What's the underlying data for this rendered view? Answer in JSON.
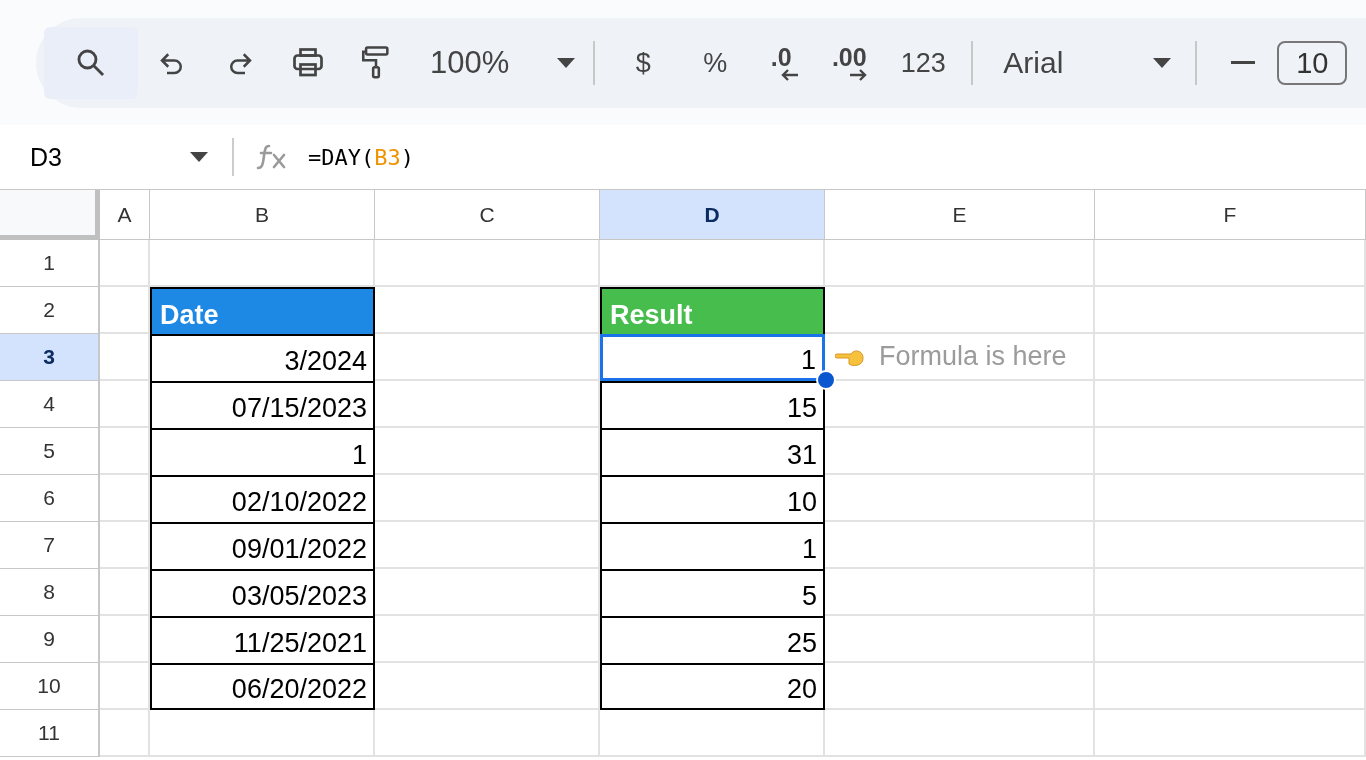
{
  "toolbar": [
    {
      "kind": "search"
    },
    {
      "kind": "undo"
    },
    {
      "kind": "redo"
    },
    {
      "kind": "print"
    },
    {
      "kind": "paint-format"
    },
    {
      "kind": "zoom",
      "text": "100%"
    },
    {
      "kind": "separator"
    },
    {
      "kind": "text",
      "text": "$"
    },
    {
      "kind": "text",
      "text": "%"
    },
    {
      "kind": "decimal-decrease",
      "text": ".0"
    },
    {
      "kind": "decimal-increase",
      "text": ".00"
    },
    {
      "kind": "text",
      "text": "123"
    },
    {
      "kind": "separator"
    },
    {
      "kind": "font",
      "text": "Arial"
    },
    {
      "kind": "separator"
    },
    {
      "kind": "minus"
    },
    {
      "kind": "font-size",
      "text": "10"
    }
  ],
  "name_box": "D3",
  "formula": [
    {
      "text": "=DAY(",
      "kind": "plain"
    },
    {
      "text": "B3",
      "kind": "reference"
    },
    {
      "text": ")",
      "kind": "plain"
    }
  ],
  "columns": [
    {
      "label": "A",
      "selected": false
    },
    {
      "label": "B",
      "selected": false
    },
    {
      "label": "C",
      "selected": false
    },
    {
      "label": "D",
      "selected": true
    },
    {
      "label": "E",
      "selected": false
    },
    {
      "label": "F",
      "selected": false
    }
  ],
  "rows": [
    {
      "label": "1",
      "selected": false
    },
    {
      "label": "2",
      "selected": false
    },
    {
      "label": "3",
      "selected": true
    },
    {
      "label": "4",
      "selected": false
    },
    {
      "label": "5",
      "selected": false
    },
    {
      "label": "6",
      "selected": false
    },
    {
      "label": "7",
      "selected": false
    },
    {
      "label": "8",
      "selected": false
    },
    {
      "label": "9",
      "selected": false
    },
    {
      "label": "10",
      "selected": false
    },
    {
      "label": "11",
      "selected": false
    }
  ],
  "tables": [
    {
      "header": "Date",
      "color": "#1e88e5",
      "values": [
        {
          "text": "3/2024",
          "selected": false
        },
        {
          "text": "07/15/2023",
          "selected": false
        },
        {
          "text": "1",
          "selected": false
        },
        {
          "text": "02/10/2022",
          "selected": false
        },
        {
          "text": "09/01/2022",
          "selected": false
        },
        {
          "text": "03/05/2023",
          "selected": false
        },
        {
          "text": "11/25/2021",
          "selected": false
        },
        {
          "text": "06/20/2022",
          "selected": false
        }
      ]
    },
    {
      "header": "Result",
      "color": "#46bd4c",
      "values": [
        {
          "text": "1",
          "selected": true
        },
        {
          "text": "15",
          "selected": false
        },
        {
          "text": "31",
          "selected": false
        },
        {
          "text": "10",
          "selected": false
        },
        {
          "text": "1",
          "selected": false
        },
        {
          "text": "5",
          "selected": false
        },
        {
          "text": "25",
          "selected": false
        },
        {
          "text": "20",
          "selected": false
        }
      ]
    }
  ],
  "note": {
    "text": "Formula is here"
  }
}
